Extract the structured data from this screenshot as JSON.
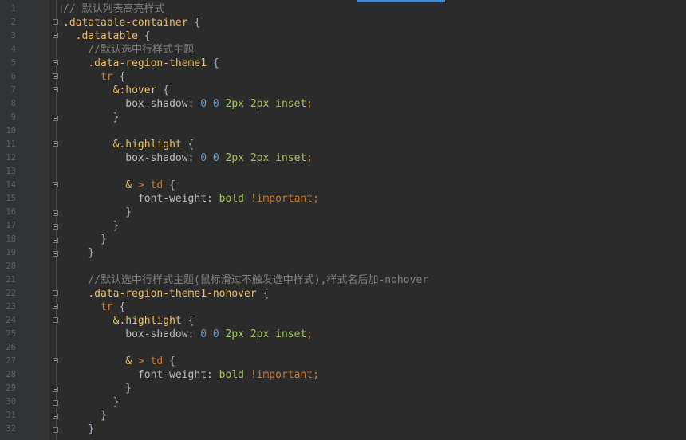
{
  "colors": {
    "background": "#2b2b2b",
    "gutter": "#313335",
    "line_number": "#606366",
    "comment": "#808080",
    "selector": "#e8bf6a",
    "tag": "#cc7832",
    "number": "#6897bb",
    "unit_value": "#a5c25c",
    "text": "#a9b7c6",
    "tab_indicator": "#4a88c7"
  },
  "icons": {
    "fold_open": "fold-open-icon",
    "fold_close": "fold-close-icon"
  },
  "lines": [
    {
      "n": "1",
      "indent": "",
      "fold": "",
      "tokens": [
        {
          "c": "cmt",
          "t": "// 默认列表高亮样式"
        }
      ]
    },
    {
      "n": "2",
      "indent": "",
      "fold": "open",
      "tokens": [
        {
          "c": "sel",
          "t": ".datatable-container"
        },
        {
          "c": "pun",
          "t": " {"
        }
      ]
    },
    {
      "n": "3",
      "indent": "  ",
      "fold": "open",
      "tokens": [
        {
          "c": "sel",
          "t": ".datatable"
        },
        {
          "c": "pun",
          "t": " {"
        }
      ]
    },
    {
      "n": "4",
      "indent": "    ",
      "fold": "",
      "tokens": [
        {
          "c": "cmt",
          "t": "//默认选中行样式主题"
        }
      ]
    },
    {
      "n": "5",
      "indent": "    ",
      "fold": "open",
      "tokens": [
        {
          "c": "sel",
          "t": ".data-region-theme1"
        },
        {
          "c": "pun",
          "t": " {"
        }
      ]
    },
    {
      "n": "6",
      "indent": "      ",
      "fold": "open",
      "tokens": [
        {
          "c": "tag",
          "t": "tr"
        },
        {
          "c": "pun",
          "t": " {"
        }
      ]
    },
    {
      "n": "7",
      "indent": "        ",
      "fold": "open",
      "tokens": [
        {
          "c": "sel",
          "t": "&:hover"
        },
        {
          "c": "pun",
          "t": " {"
        }
      ]
    },
    {
      "n": "8",
      "indent": "          ",
      "fold": "",
      "tokens": [
        {
          "c": "prop",
          "t": "box-shadow"
        },
        {
          "c": "pun",
          "t": ": "
        },
        {
          "c": "num",
          "t": "0"
        },
        {
          "c": "pun",
          "t": " "
        },
        {
          "c": "num",
          "t": "0"
        },
        {
          "c": "pun",
          "t": " "
        },
        {
          "c": "unit",
          "t": "2px"
        },
        {
          "c": "pun",
          "t": " "
        },
        {
          "c": "unit",
          "t": "2px"
        },
        {
          "c": "pun",
          "t": " "
        },
        {
          "c": "kw",
          "t": "inset"
        },
        {
          "c": "imp",
          "t": ";"
        }
      ]
    },
    {
      "n": "9",
      "indent": "        ",
      "fold": "close",
      "tokens": [
        {
          "c": "pun",
          "t": "}"
        }
      ]
    },
    {
      "n": "10",
      "indent": "",
      "fold": "",
      "tokens": []
    },
    {
      "n": "11",
      "indent": "        ",
      "fold": "open",
      "tokens": [
        {
          "c": "sel",
          "t": "&.highlight"
        },
        {
          "c": "pun",
          "t": " {"
        }
      ]
    },
    {
      "n": "12",
      "indent": "          ",
      "fold": "",
      "tokens": [
        {
          "c": "prop",
          "t": "box-shadow"
        },
        {
          "c": "pun",
          "t": ": "
        },
        {
          "c": "num",
          "t": "0"
        },
        {
          "c": "pun",
          "t": " "
        },
        {
          "c": "num",
          "t": "0"
        },
        {
          "c": "pun",
          "t": " "
        },
        {
          "c": "unit",
          "t": "2px"
        },
        {
          "c": "pun",
          "t": " "
        },
        {
          "c": "unit",
          "t": "2px"
        },
        {
          "c": "pun",
          "t": " "
        },
        {
          "c": "kw",
          "t": "inset"
        },
        {
          "c": "imp",
          "t": ";"
        }
      ]
    },
    {
      "n": "13",
      "indent": "",
      "fold": "",
      "tokens": []
    },
    {
      "n": "14",
      "indent": "          ",
      "fold": "open",
      "tokens": [
        {
          "c": "sel",
          "t": "&"
        },
        {
          "c": "pun",
          "t": " "
        },
        {
          "c": "tag",
          "t": ">"
        },
        {
          "c": "pun",
          "t": " "
        },
        {
          "c": "tag",
          "t": "td"
        },
        {
          "c": "pun",
          "t": " {"
        }
      ]
    },
    {
      "n": "15",
      "indent": "            ",
      "fold": "",
      "tokens": [
        {
          "c": "prop",
          "t": "font-weight"
        },
        {
          "c": "pun",
          "t": ": "
        },
        {
          "c": "kw",
          "t": "bold"
        },
        {
          "c": "pun",
          "t": " "
        },
        {
          "c": "imp",
          "t": "!important;"
        }
      ]
    },
    {
      "n": "16",
      "indent": "          ",
      "fold": "close",
      "tokens": [
        {
          "c": "pun",
          "t": "}"
        }
      ]
    },
    {
      "n": "17",
      "indent": "        ",
      "fold": "close",
      "tokens": [
        {
          "c": "pun",
          "t": "}"
        }
      ]
    },
    {
      "n": "18",
      "indent": "      ",
      "fold": "close",
      "tokens": [
        {
          "c": "pun",
          "t": "}"
        }
      ]
    },
    {
      "n": "19",
      "indent": "    ",
      "fold": "close",
      "tokens": [
        {
          "c": "pun",
          "t": "}"
        }
      ]
    },
    {
      "n": "20",
      "indent": "",
      "fold": "",
      "tokens": []
    },
    {
      "n": "21",
      "indent": "    ",
      "fold": "",
      "tokens": [
        {
          "c": "cmt",
          "t": "//默认选中行样式主题(鼠标滑过不触发选中样式),样式名后加-nohover"
        }
      ]
    },
    {
      "n": "22",
      "indent": "    ",
      "fold": "open",
      "tokens": [
        {
          "c": "sel",
          "t": ".data-region-theme1-nohover"
        },
        {
          "c": "pun",
          "t": " {"
        }
      ]
    },
    {
      "n": "23",
      "indent": "      ",
      "fold": "open",
      "tokens": [
        {
          "c": "tag",
          "t": "tr"
        },
        {
          "c": "pun",
          "t": " {"
        }
      ]
    },
    {
      "n": "24",
      "indent": "        ",
      "fold": "open",
      "tokens": [
        {
          "c": "sel",
          "t": "&.highlight"
        },
        {
          "c": "pun",
          "t": " {"
        }
      ]
    },
    {
      "n": "25",
      "indent": "          ",
      "fold": "",
      "tokens": [
        {
          "c": "prop",
          "t": "box-shadow"
        },
        {
          "c": "pun",
          "t": ": "
        },
        {
          "c": "num",
          "t": "0"
        },
        {
          "c": "pun",
          "t": " "
        },
        {
          "c": "num",
          "t": "0"
        },
        {
          "c": "pun",
          "t": " "
        },
        {
          "c": "unit",
          "t": "2px"
        },
        {
          "c": "pun",
          "t": " "
        },
        {
          "c": "unit",
          "t": "2px"
        },
        {
          "c": "pun",
          "t": " "
        },
        {
          "c": "kw",
          "t": "inset"
        },
        {
          "c": "imp",
          "t": ";"
        }
      ]
    },
    {
      "n": "26",
      "indent": "",
      "fold": "",
      "tokens": []
    },
    {
      "n": "27",
      "indent": "          ",
      "fold": "open",
      "tokens": [
        {
          "c": "sel",
          "t": "&"
        },
        {
          "c": "pun",
          "t": " "
        },
        {
          "c": "tag",
          "t": ">"
        },
        {
          "c": "pun",
          "t": " "
        },
        {
          "c": "tag",
          "t": "td"
        },
        {
          "c": "pun",
          "t": " {"
        }
      ]
    },
    {
      "n": "28",
      "indent": "            ",
      "fold": "",
      "tokens": [
        {
          "c": "prop",
          "t": "font-weight"
        },
        {
          "c": "pun",
          "t": ": "
        },
        {
          "c": "kw",
          "t": "bold"
        },
        {
          "c": "pun",
          "t": " "
        },
        {
          "c": "imp",
          "t": "!important;"
        }
      ]
    },
    {
      "n": "29",
      "indent": "          ",
      "fold": "close",
      "tokens": [
        {
          "c": "pun",
          "t": "}"
        }
      ]
    },
    {
      "n": "30",
      "indent": "        ",
      "fold": "close",
      "tokens": [
        {
          "c": "pun",
          "t": "}"
        }
      ]
    },
    {
      "n": "31",
      "indent": "      ",
      "fold": "close",
      "tokens": [
        {
          "c": "pun",
          "t": "}"
        }
      ]
    },
    {
      "n": "32",
      "indent": "    ",
      "fold": "close",
      "tokens": [
        {
          "c": "pun",
          "t": "}"
        }
      ]
    }
  ]
}
